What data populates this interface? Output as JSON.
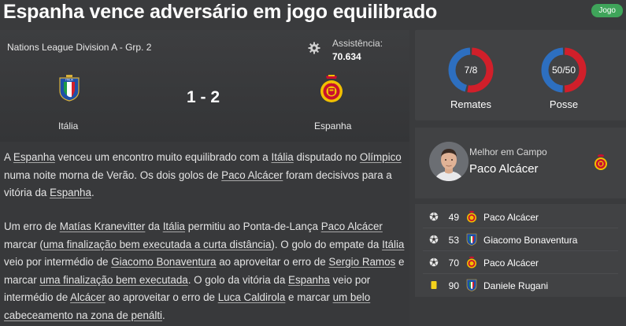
{
  "headline": "Espanha vence adversário em jogo equilibrado",
  "badge": "Jogo",
  "match": {
    "competition": "Nations League Division A - Grp. 2",
    "attendance_label": "Assistência:",
    "attendance_value": "70.634",
    "score": "1 - 2",
    "home_team": "Itália",
    "away_team": "Espanha",
    "home_crest_text": "ITALIA"
  },
  "stats": {
    "shots": {
      "label": "Remates",
      "value_text": "7/8",
      "home": 7,
      "away": 8
    },
    "possession": {
      "label": "Posse",
      "value_text": "50/50",
      "home": 50,
      "away": 50
    },
    "colors": {
      "home": "#2d6fc0",
      "away": "#d11f2a"
    }
  },
  "man_of_match": {
    "label": "Melhor em Campo",
    "name": "Paco Alcácer"
  },
  "events": [
    {
      "type": "goal",
      "icon": "ball-icon",
      "minute": "49",
      "team": "away",
      "player": "Paco Alcácer"
    },
    {
      "type": "goal",
      "icon": "ball-icon",
      "minute": "53",
      "team": "home",
      "player": "Giacomo Bonaventura"
    },
    {
      "type": "goal",
      "icon": "ball-icon",
      "minute": "70",
      "team": "away",
      "player": "Paco Alcácer"
    },
    {
      "type": "yellow-card",
      "icon": "yellow-card-icon",
      "minute": "90",
      "team": "home",
      "player": "Daniele Rugani"
    }
  ],
  "article": {
    "p1": [
      {
        "t": "A "
      },
      {
        "t": "Espanha",
        "link": true
      },
      {
        "t": " venceu um encontro muito equilibrado com a "
      },
      {
        "t": "Itália",
        "link": true
      },
      {
        "t": " disputado no "
      },
      {
        "t": "Olímpico",
        "link": true
      },
      {
        "t": " numa noite morna de Verão. Os dois golos de "
      },
      {
        "t": "Paco Alcácer",
        "link": true
      },
      {
        "t": " foram decisivos para a vitória da "
      },
      {
        "t": "Espanha",
        "link": true
      },
      {
        "t": "."
      }
    ],
    "p2": [
      {
        "t": "Um erro de "
      },
      {
        "t": "Matías Kranevitter",
        "link": true
      },
      {
        "t": " da "
      },
      {
        "t": "Itália",
        "link": true
      },
      {
        "t": " permitiu ao Ponta-de-Lança "
      },
      {
        "t": "Paco Alcácer",
        "link": true
      },
      {
        "t": " marcar ("
      },
      {
        "t": "uma finalização bem executada a curta distância",
        "link": true
      },
      {
        "t": "). O golo do empate da "
      },
      {
        "t": "Itália",
        "link": true
      },
      {
        "t": " veio por intermédio de "
      },
      {
        "t": "Giacomo Bonaventura",
        "link": true
      },
      {
        "t": " ao aproveitar o erro de "
      },
      {
        "t": "Sergio Ramos",
        "link": true
      },
      {
        "t": " e marcar "
      },
      {
        "t": "uma finalização bem executada",
        "link": true
      },
      {
        "t": ". O golo da vitória da "
      },
      {
        "t": "Espanha",
        "link": true
      },
      {
        "t": " veio por intermédio de "
      },
      {
        "t": "Alcácer",
        "link": true
      },
      {
        "t": " ao aproveitar o erro de "
      },
      {
        "t": "Luca Caldirola",
        "link": true
      },
      {
        "t": " e marcar "
      },
      {
        "t": "um belo cabeceamento na zona de penálti",
        "link": true
      },
      {
        "t": "."
      }
    ]
  }
}
